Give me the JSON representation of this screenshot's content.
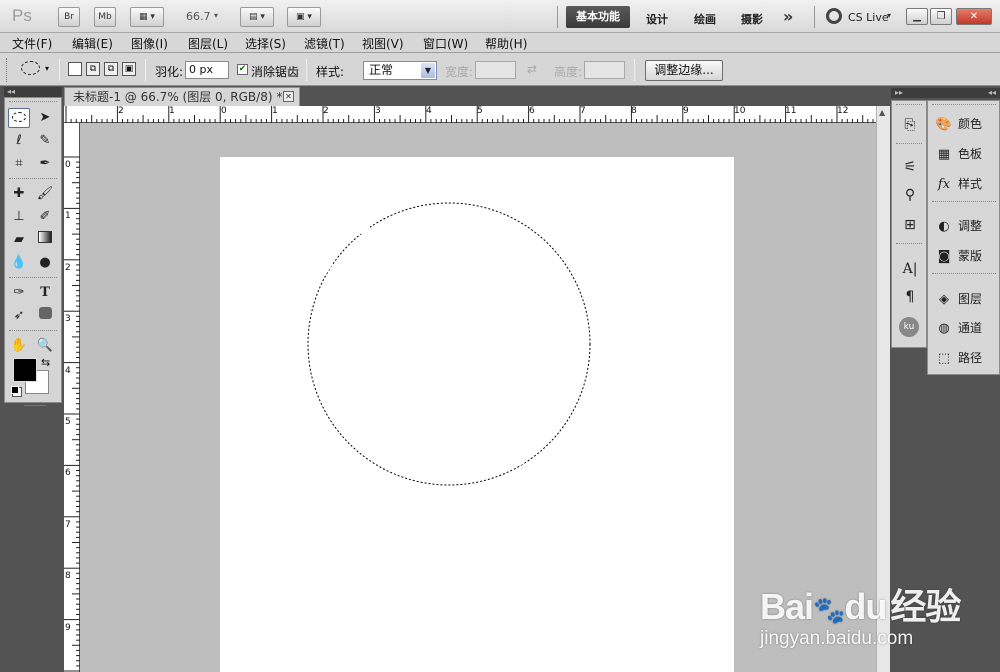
{
  "appbar": {
    "logo": "Ps",
    "bridge_label": "Br",
    "minibridge_label": "Mb",
    "zoom": "66.7",
    "workspaces": {
      "active": "基本功能",
      "items": [
        "设计",
        "绘画",
        "摄影"
      ],
      "more": "»"
    },
    "cslive": "CS Live"
  },
  "menu": [
    "文件(F)",
    "编辑(E)",
    "图像(I)",
    "图层(L)",
    "选择(S)",
    "滤镜(T)",
    "视图(V)",
    "窗口(W)",
    "帮助(H)"
  ],
  "options": {
    "feather_label": "羽化:",
    "feather_value": "0 px",
    "antialias_label": "消除锯齿",
    "antialias_checked": true,
    "style_label": "样式:",
    "style_value": "正常",
    "width_label": "宽度:",
    "height_label": "高度:",
    "refine_edge_label": "调整边缘..."
  },
  "document": {
    "tab_title": "未标题-1 @ 66.7% (图层 0, RGB/8) *",
    "hruler_ticks": [
      "2",
      "1",
      "0",
      "1",
      "2",
      "3",
      "4",
      "5",
      "6",
      "7",
      "8",
      "9",
      "10",
      "11",
      "12"
    ],
    "vruler_ticks": [
      "0",
      "1",
      "2",
      "3",
      "4",
      "5",
      "6",
      "7",
      "8",
      "9"
    ]
  },
  "panels": {
    "items": [
      {
        "icon": "palette-icon",
        "label": "颜色"
      },
      {
        "icon": "swatches-icon",
        "label": "色板"
      },
      {
        "icon": "fx-icon",
        "label": "样式"
      },
      {
        "icon": "adjustments-icon",
        "label": "调整"
      },
      {
        "icon": "mask-icon",
        "label": "蒙版"
      },
      {
        "icon": "layers-icon",
        "label": "图层"
      },
      {
        "icon": "channels-icon",
        "label": "通道"
      },
      {
        "icon": "paths-icon",
        "label": "路径"
      }
    ]
  },
  "watermark": {
    "brand": "Bai",
    "brand2": "du",
    "suffix": "经验",
    "url": "jingyan.baidu.com"
  },
  "colors": {
    "foreground": "#000000",
    "background": "#ffffff",
    "workspace_active": "#3f3f3f"
  }
}
